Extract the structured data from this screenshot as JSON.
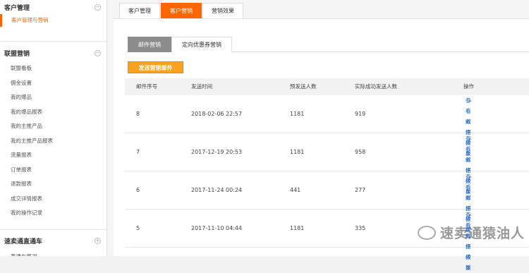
{
  "sidebar": {
    "sections": [
      {
        "title": "客户管理",
        "toggle": "−",
        "active_item": "客户管理与营销",
        "items": []
      },
      {
        "title": "联盟营销",
        "toggle": "−",
        "items": [
          "联盟看板",
          "佣金设置",
          "我的爆品",
          "我的爆品报表",
          "我的主推产品",
          "我的主推产品报表",
          "流量报表",
          "订单报表",
          "退款报表",
          "成交详情报表",
          "我的操作记录"
        ]
      },
      {
        "title": "速卖通直通车",
        "toggle": "+",
        "items": [
          "直通车概况"
        ]
      }
    ]
  },
  "top_tabs": [
    "客户管理",
    "客户营销",
    "营销效果"
  ],
  "sub_tabs": [
    "邮件营销",
    "定向优惠券营销"
  ],
  "send_button": "发送营销邮件",
  "table": {
    "headers": [
      "邮件序号",
      "发送时间",
      "预发送人数",
      "实际成功发送人数",
      "操作"
    ],
    "rows": [
      {
        "id": "8",
        "time": "2018-02-06 22:57",
        "planned": "1181",
        "sent": "919",
        "action1": "查看邮件模板",
        "action2": "查看数据效果"
      },
      {
        "id": "7",
        "time": "2017-12-19 20:53",
        "planned": "1181",
        "sent": "958",
        "action1": "查看邮件模板",
        "action2": "查看数据效果"
      },
      {
        "id": "6",
        "time": "2017-11-24 00:24",
        "planned": "441",
        "sent": "277",
        "action1": "查看邮件模板",
        "action2": "查看数据效果"
      },
      {
        "id": "5",
        "time": "2017-11-10 04:44",
        "planned": "1181",
        "sent": "335",
        "action1": "查看邮件模板",
        "action2": "查看数据效果"
      }
    ]
  },
  "watermark": "速卖通猿油人",
  "colors": {
    "accent": "#ff6600",
    "button": "#f7a31e",
    "link": "#2a6cc7"
  }
}
